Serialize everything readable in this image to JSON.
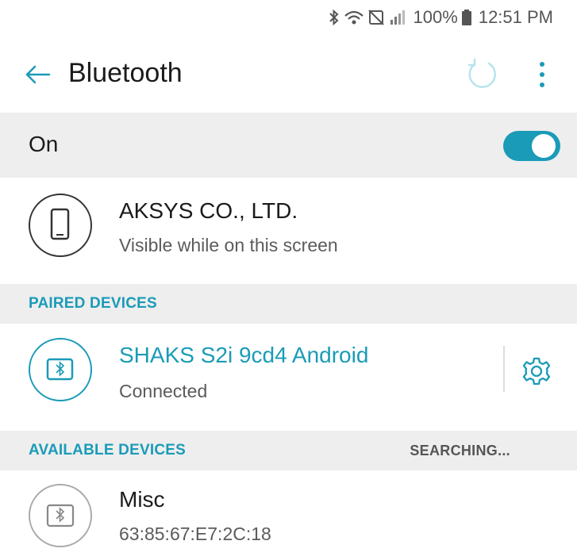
{
  "status_bar": {
    "battery": "100%",
    "time": "12:51 PM",
    "icons": [
      "bluetooth-icon",
      "wifi-icon",
      "nfc-icon",
      "signal-icon",
      "battery-icon"
    ]
  },
  "app_bar": {
    "title": "Bluetooth",
    "icons": [
      "back-arrow-icon",
      "refresh-icon",
      "more-vert-icon"
    ]
  },
  "toggle": {
    "label": "On",
    "state": "on"
  },
  "this_device": {
    "name": "AKSYS CO., LTD.",
    "subtitle": "Visible while on this screen",
    "icon": "phone-icon"
  },
  "paired_section": {
    "title": "PAIRED DEVICES",
    "devices": [
      {
        "name": "SHAKS S2i 9cd4 Android",
        "status": "Connected",
        "icon": "bluetooth-device-icon",
        "action_icon": "gear-icon"
      }
    ]
  },
  "available_section": {
    "title": "AVAILABLE DEVICES",
    "status": "SEARCHING...",
    "devices": [
      {
        "name": "Misc",
        "address": "63:85:67:E7:2C:18",
        "icon": "bluetooth-device-icon"
      }
    ]
  },
  "colors": {
    "accent": "#1a9bb8",
    "section_bg": "#eeeeee",
    "text_primary": "#1b1b1b",
    "text_secondary": "#5b5b5b"
  }
}
